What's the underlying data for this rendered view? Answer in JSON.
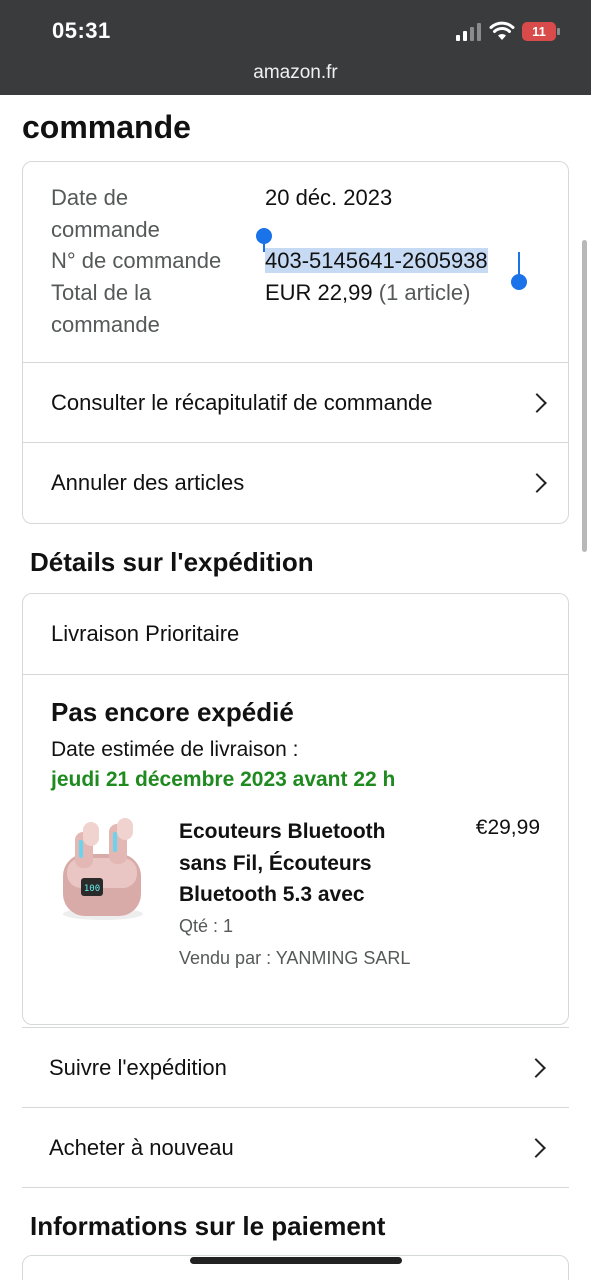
{
  "status_bar": {
    "time": "05:31",
    "battery": "11",
    "battery_color": "#d94a4a",
    "icons": [
      "signal-icon",
      "wifi-icon",
      "battery-icon"
    ]
  },
  "browser": {
    "url": "amazon.fr"
  },
  "page": {
    "heading": "commande",
    "order_info": {
      "date_label": "Date de commande",
      "date_value": "20 déc. 2023",
      "number_label": "N° de commande",
      "number_value": "403-5145641-2605938",
      "total_label": "Total de la commande",
      "total_value": "EUR 22,99",
      "total_items": "(1 article)"
    },
    "order_actions": [
      {
        "label": "Consulter le récapitulatif de commande"
      },
      {
        "label": "Annuler des articles"
      }
    ],
    "shipping": {
      "title": "Détails sur l'expédition",
      "method": "Livraison Prioritaire",
      "status": "Pas encore expédié",
      "estimate_label": "Date estimée de livraison :",
      "estimate_date": "jeudi 21 décembre 2023 avant 22 h",
      "estimate_color": "#1f8a1f",
      "product": {
        "name": "Ecouteurs Bluetooth sans Fil, Écouteurs Bluetooth 5.3 avec",
        "price": "€29,99",
        "qty": "Qté : 1",
        "seller": "Vendu par : YANMING SARL"
      }
    },
    "shipping_actions": [
      {
        "label": "Suivre l'expédition"
      },
      {
        "label": "Acheter à nouveau"
      }
    ],
    "payment_title": "Informations sur le paiement"
  }
}
